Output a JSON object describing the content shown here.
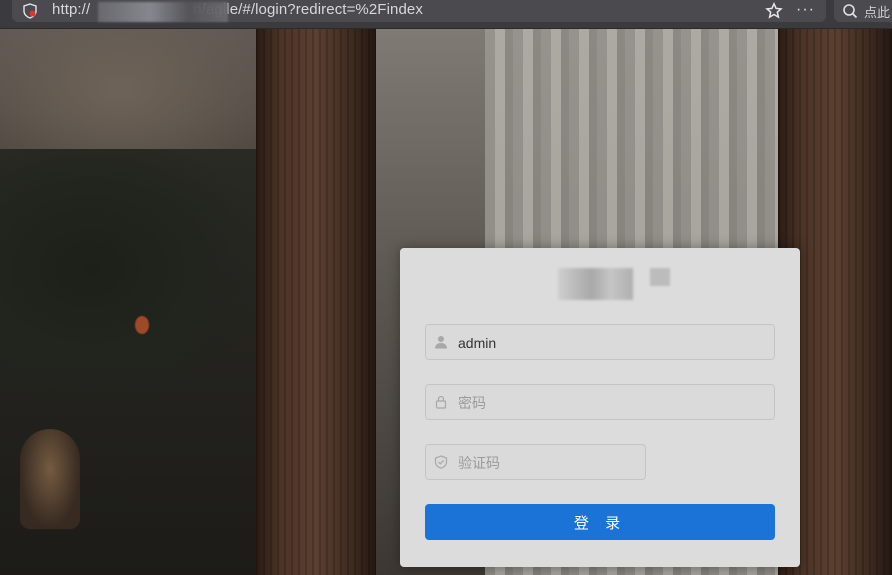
{
  "browser": {
    "url": "http://",
    "url_suffix": "n/agile/#/login?redirect=%2Findex",
    "more": "···",
    "search_placeholder": "点此"
  },
  "login": {
    "username_value": "admin",
    "password_placeholder": "密码",
    "captcha_placeholder": "验证码",
    "submit_label": "登 录"
  },
  "colors": {
    "primary": "#1b73d8",
    "card_bg": "#dcdcdc"
  }
}
